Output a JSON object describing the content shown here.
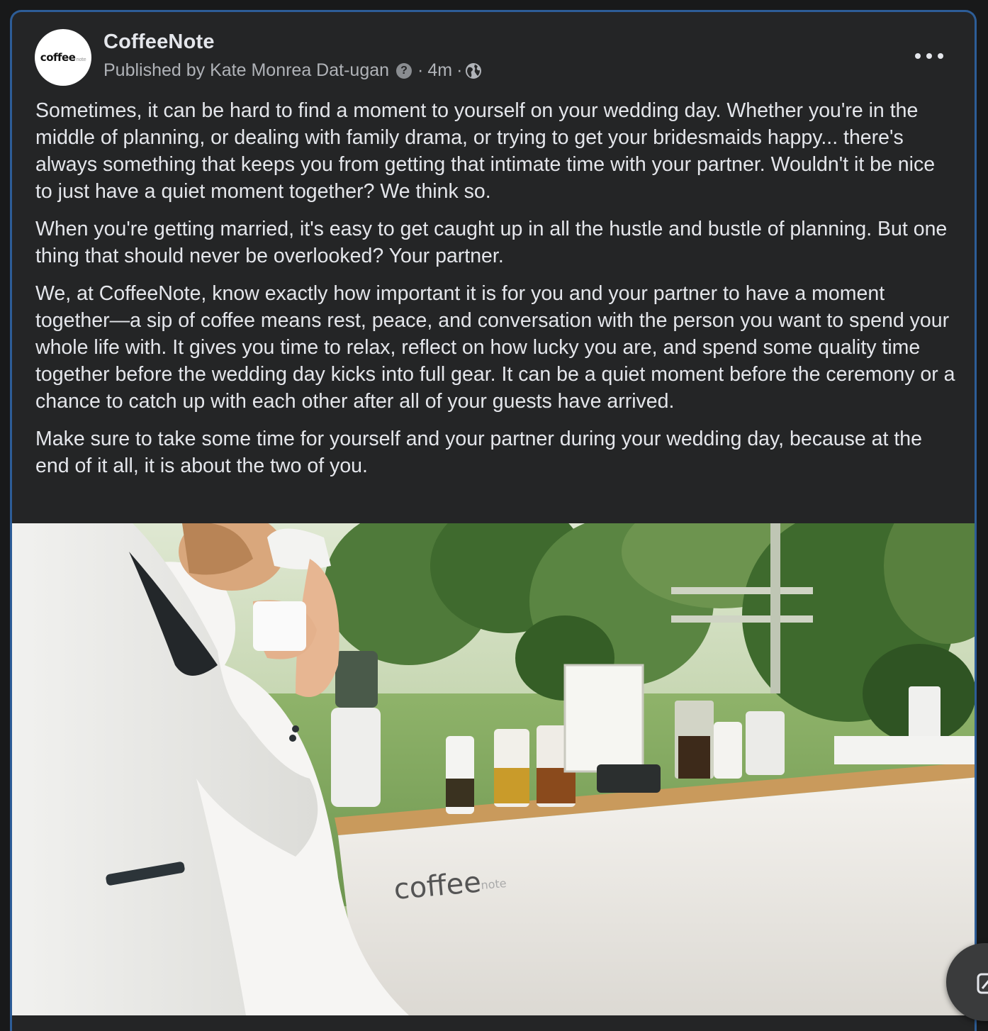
{
  "post": {
    "page_name": "CoffeeNote",
    "avatar_logo": {
      "main": "coffee",
      "small": "note"
    },
    "published_by": "Published by Kate Monrea Dat-ugan",
    "help_icon": "?",
    "separator": "·",
    "time": "4m",
    "audience_icon": "globe-icon",
    "more_icon": "more-horizontal-icon",
    "paragraphs": [
      "Sometimes, it can be hard to find a moment to yourself on your wedding day. Whether you're in the middle of planning, or dealing with family drama, or trying to get your bridesmaids happy... there's always something that keeps you from getting that intimate time with your partner. Wouldn't it be nice to just have a quiet moment together? We think so.",
      "When you're getting married, it's easy to get caught up in all the hustle and bustle of planning. But one thing that should never be overlooked? Your partner.",
      "We, at CoffeeNote, know exactly how important it is for you and your partner to have a moment together—a sip of coffee means rest, peace, and conversation with the person you want to spend your whole life with. It gives you time  to relax, reflect on how lucky you are, and spend some quality time together before the wedding day kicks into full gear. It can be a quiet moment before the ceremony or a chance to catch up with each other after all of your guests have arrived.",
      "Make sure to take some time for yourself and your partner during your wedding day, because at the end of it all,  it is about the two of you."
    ],
    "photo": {
      "cart_logo_main": "coffee",
      "cart_logo_small": "note"
    }
  },
  "colors": {
    "background": "#18191a",
    "card": "#242526",
    "card_border": "#2d5d97",
    "text_primary": "#e4e6eb",
    "text_secondary": "#b0b3b8"
  }
}
